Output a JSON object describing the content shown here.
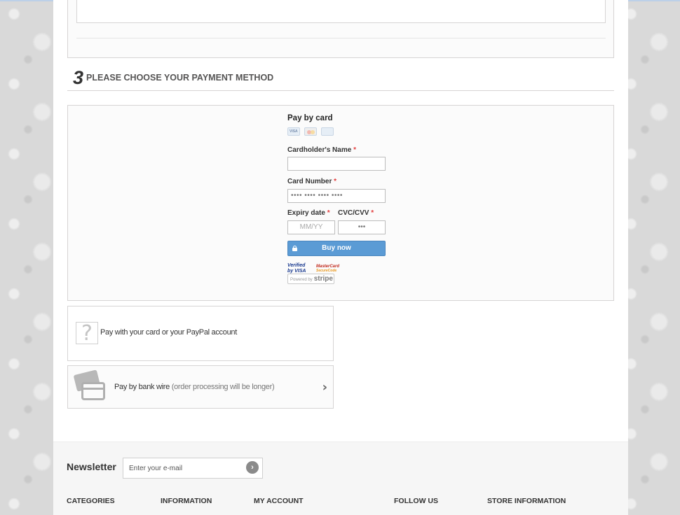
{
  "step": {
    "number": "3",
    "title": "PLEASE CHOOSE YOUR PAYMENT METHOD"
  },
  "stripe": {
    "title": "Pay by card",
    "cardholder_label": "Cardholder's Name",
    "card_number_label": "Card Number",
    "card_number_placeholder": "•••• •••• •••• ••••",
    "expiry_label": "Expiry date",
    "expiry_placeholder": "MM/YY",
    "cvc_label": "CVC/CVV",
    "cvc_placeholder": "•••",
    "required_mark": "*",
    "buy_label": "Buy now",
    "verified_visa": "Verified by VISA",
    "mastercard_secure": "MasterCard",
    "mastercard_secure_sub": "SecureCode",
    "powered_by": "Powered by",
    "stripe_word": "stripe"
  },
  "options": {
    "paypal": "Pay with your card or your PayPal account",
    "bankwire": "Pay by bank wire",
    "bankwire_note": "(order processing will be longer)"
  },
  "footer": {
    "newsletter_title": "Newsletter",
    "newsletter_placeholder": "Enter your e-mail",
    "newsletter_button": "›",
    "columns": [
      "CATEGORIES",
      "INFORMATION",
      "MY ACCOUNT",
      "FOLLOW US",
      "STORE INFORMATION"
    ]
  },
  "colors": {
    "buy_button": "#5b9bd5",
    "required": "#e23a3a"
  }
}
